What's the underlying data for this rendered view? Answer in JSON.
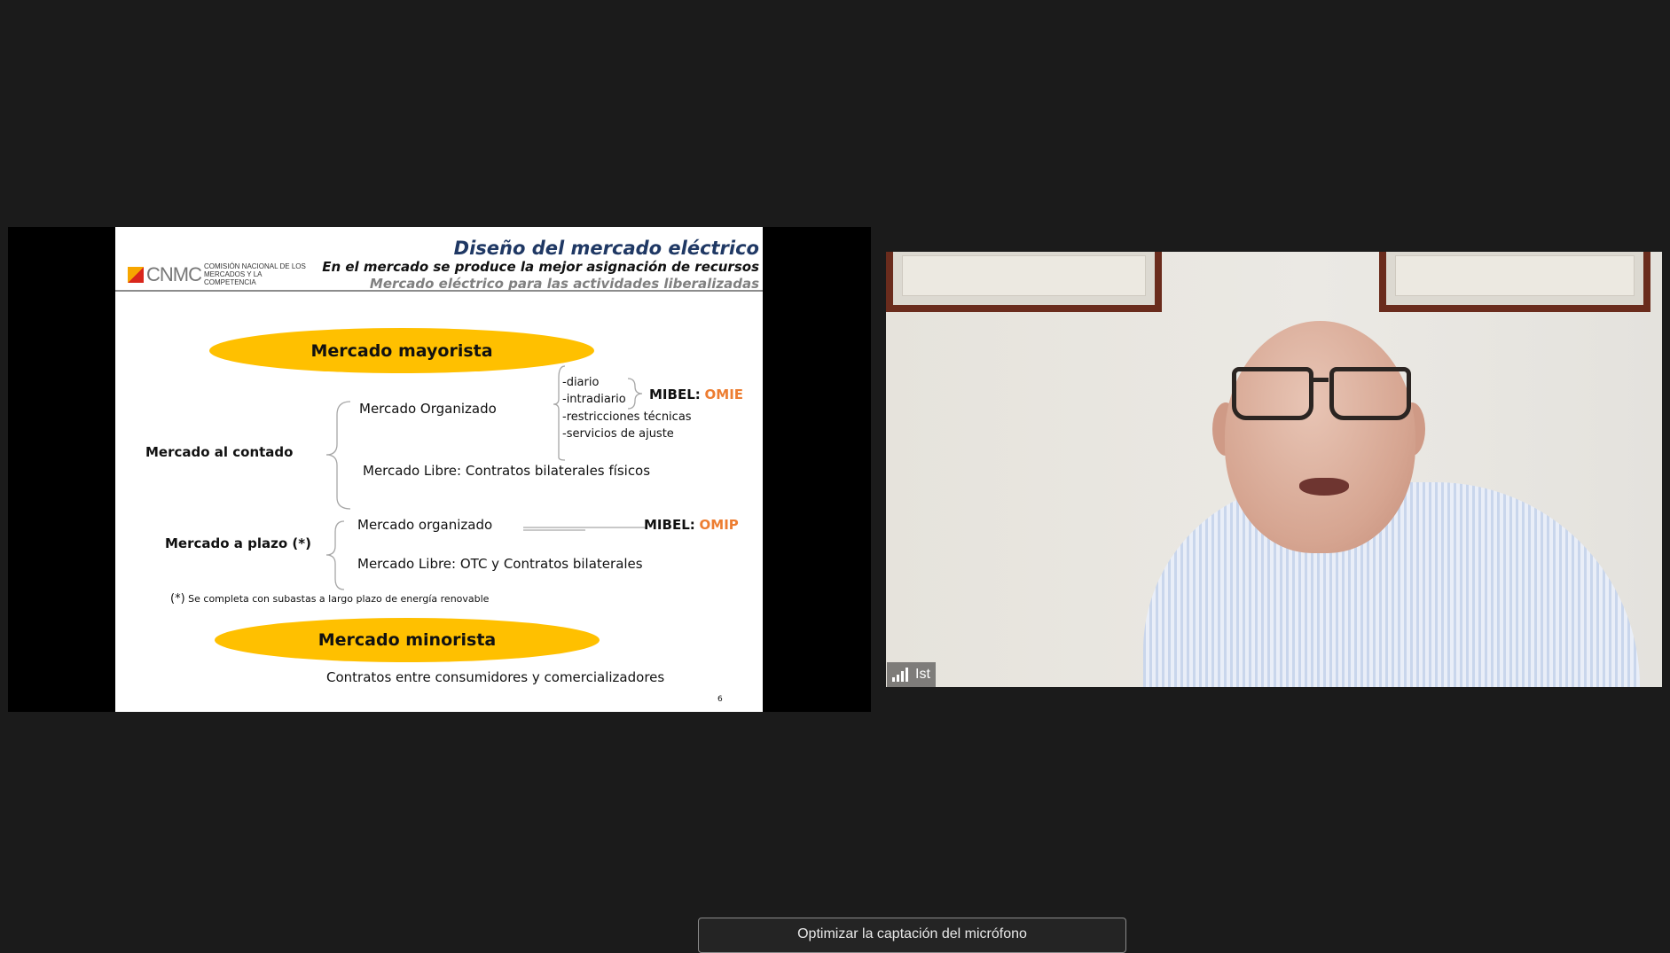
{
  "slide": {
    "logo": {
      "wordmark": "CNMC",
      "subtitle": "COMISIÓN NACIONAL DE LOS MERCADOS Y LA COMPETENCIA"
    },
    "title": "Diseño del mercado eléctrico",
    "subtitle1": "En el mercado se produce la mejor asignación de recursos",
    "subtitle2": "Mercado eléctrico para las actividades liberalizadas",
    "wholesale": "Mercado mayorista",
    "spot_label": "Mercado al contado",
    "organized_label": "Mercado Organizado",
    "spot_items": [
      "-diario",
      "-intradiario",
      "-restricciones técnicas",
      "-servicios de ajuste"
    ],
    "omie_prefix": "MIBEL:",
    "omie": "OMIE",
    "free_spot": "Mercado Libre: Contratos bilaterales físicos",
    "forward_label": "Mercado a plazo (*)",
    "forward_organized": "Mercado organizado",
    "omip_prefix": "MIBEL:",
    "omip": "OMIP",
    "forward_free": "Mercado Libre: OTC y Contratos bilaterales",
    "footnote_mark": "(*)",
    "footnote": "Se completa con subastas a largo plazo de energía renovable",
    "retail": "Mercado minorista",
    "retail_desc": "Contratos entre consumidores y comercializadores",
    "page_number": "6"
  },
  "participant": {
    "name": "Ist"
  },
  "toast": {
    "text": "Optimizar la captación del micrófono"
  },
  "colors": {
    "ellipse": "#ffc000",
    "mibel_accent": "#ed7d31",
    "title": "#1f3864"
  }
}
